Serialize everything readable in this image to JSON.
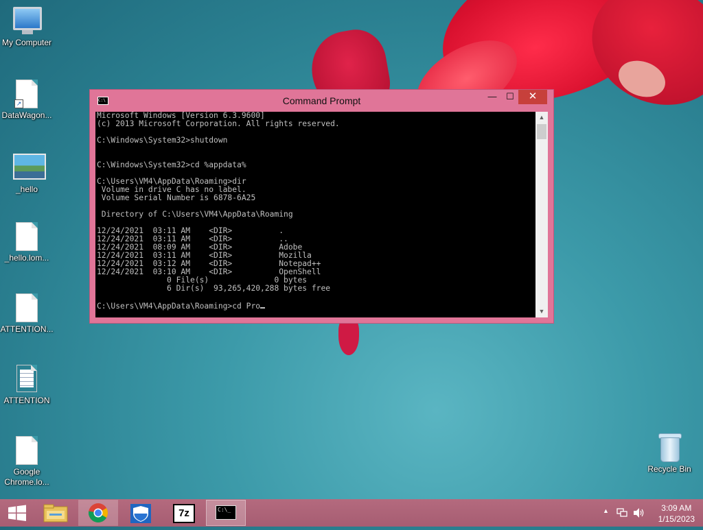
{
  "window": {
    "title": "Command Prompt",
    "minimize": "—",
    "maximize": "☐",
    "close": "✕",
    "console_lines": [
      "Microsoft Windows [Version 6.3.9600]",
      "(c) 2013 Microsoft Corporation. All rights reserved.",
      "",
      "C:\\Windows\\System32>shutdown",
      "",
      "",
      "C:\\Windows\\System32>cd %appdata%",
      "",
      "C:\\Users\\VM4\\AppData\\Roaming>dir",
      " Volume in drive C has no label.",
      " Volume Serial Number is 6878-6A25",
      "",
      " Directory of C:\\Users\\VM4\\AppData\\Roaming",
      "",
      "12/24/2021  03:11 AM    <DIR>          .",
      "12/24/2021  03:11 AM    <DIR>          ..",
      "12/24/2021  08:09 AM    <DIR>          Adobe",
      "12/24/2021  03:11 AM    <DIR>          Mozilla",
      "12/24/2021  03:12 AM    <DIR>          Notepad++",
      "12/24/2021  03:10 AM    <DIR>          OpenShell",
      "               0 File(s)              0 bytes",
      "               6 Dir(s)  93,265,420,288 bytes free",
      ""
    ],
    "prompt_line": "C:\\Users\\VM4\\AppData\\Roaming>cd Pro"
  },
  "desktop_icons": [
    {
      "name": "my-computer",
      "label": "My Computer",
      "icon": "computer-icon"
    },
    {
      "name": "datawagon",
      "label": "DataWagon...",
      "icon": "document-shortcut-icon"
    },
    {
      "name": "hello-image",
      "label": "_hello",
      "icon": "image-icon"
    },
    {
      "name": "hello-lom",
      "label": "_hello.lom...",
      "icon": "document-icon"
    },
    {
      "name": "attention-file",
      "label": "ATTENTION...",
      "icon": "document-icon"
    },
    {
      "name": "attention-text",
      "label": "ATTENTION",
      "icon": "text-document-icon"
    },
    {
      "name": "chrome-lo",
      "label": "Google Chrome.lo...",
      "icon": "document-icon"
    }
  ],
  "recycle_bin": {
    "label": "Recycle Bin"
  },
  "taskbar": {
    "apps": [
      "File Explorer",
      "Google Chrome",
      "Windows Defender",
      "7-Zip",
      "Command Prompt"
    ],
    "sevenzip_label": "7z",
    "cmd_label": "C:\\_",
    "time": "3:09 AM",
    "date": "1/15/2023"
  },
  "colors": {
    "window_frame": "#e07598",
    "close_button": "#c7403b",
    "console_bg": "#000000",
    "console_text": "#c0c0c0",
    "taskbar": "#aa6276"
  }
}
